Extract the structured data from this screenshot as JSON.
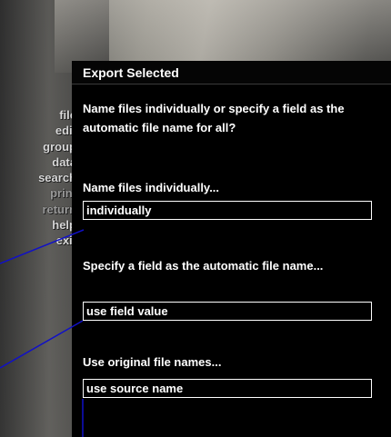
{
  "sidebar": {
    "items": [
      {
        "label": "file",
        "dim": false
      },
      {
        "label": "edit",
        "dim": false
      },
      {
        "label": "group",
        "dim": false
      },
      {
        "label": "data",
        "dim": false
      },
      {
        "label": "search",
        "dim": false
      },
      {
        "label": "print",
        "dim": true
      },
      {
        "label": "return",
        "dim": true
      },
      {
        "label": "help",
        "dim": false
      },
      {
        "label": "exit",
        "dim": false
      }
    ]
  },
  "dialog": {
    "title": "Export Selected",
    "intro": "Name files individually or specify a field as the automatic file name for all?",
    "option1_label": "Name files individually...",
    "option1_value": "individually",
    "option2_label": "Specify a field as the automatic file name...",
    "option2_value": "use field value",
    "option3_label": "Use original file names...",
    "option3_value": "use source name"
  },
  "colors": {
    "panel_bg": "#000000",
    "text": "#ffffff",
    "leader_line": "#1010c8"
  }
}
